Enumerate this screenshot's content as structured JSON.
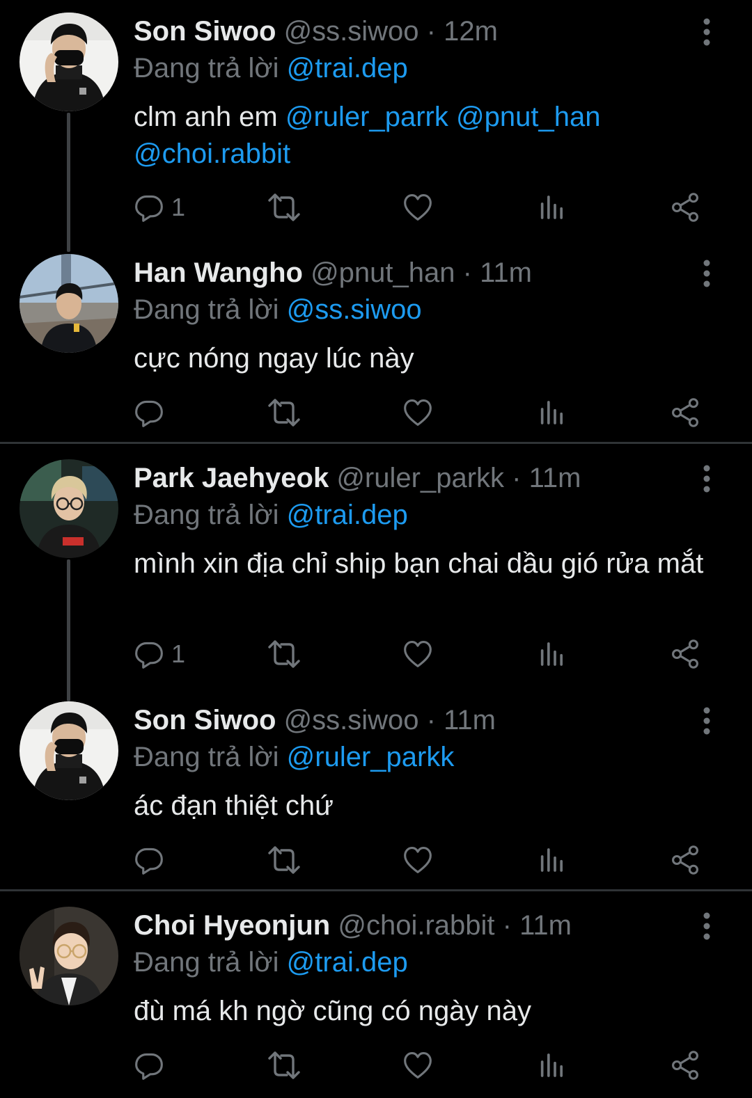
{
  "colors": {
    "background": "#000000",
    "text_primary": "#e7e9ea",
    "text_secondary": "#71767b",
    "accent_link": "#1d9bf0",
    "thread_line": "#3e4144",
    "divider": "#2f3336"
  },
  "tweets": [
    {
      "name": "Son Siwoo",
      "handle": "@ss.siwoo",
      "separator": "·",
      "time": "12m",
      "reply_prefix": "Đang trả lời",
      "reply_to": "@trai.dep",
      "body_text": "clm anh em ",
      "mentions": [
        "@ruler_parrk",
        "@pnut_han",
        "@choi.rabbit"
      ],
      "reply_count": "1",
      "avatar_icon": "avatar-masked-person",
      "menu_icon": "more-vertical-icon"
    },
    {
      "name": "Han Wangho",
      "handle": "@pnut_han",
      "separator": "·",
      "time": "11m",
      "reply_prefix": "Đang trả lời",
      "reply_to": "@ss.siwoo",
      "body_text": "cực nóng ngay lúc này",
      "reply_count": "",
      "avatar_icon": "avatar-person-bridge",
      "menu_icon": "more-vertical-icon"
    },
    {
      "name": "Park Jaehyeok",
      "handle": "@ruler_parkk",
      "separator": "·",
      "time": "11m",
      "reply_prefix": "Đang trả lời",
      "reply_to": "@trai.dep",
      "body_text": "mình xin địa chỉ ship bạn chai dầu gió rửa mắt",
      "reply_count": "1",
      "avatar_icon": "avatar-person-glasses",
      "menu_icon": "more-vertical-icon"
    },
    {
      "name": "Son Siwoo",
      "handle": "@ss.siwoo",
      "separator": "·",
      "time": "11m",
      "reply_prefix": "Đang trả lời",
      "reply_to": "@ruler_parkk",
      "body_text": "ác đạn thiệt chứ",
      "reply_count": "",
      "avatar_icon": "avatar-masked-person",
      "menu_icon": "more-vertical-icon"
    },
    {
      "name": "Choi Hyeonjun",
      "handle": "@choi.rabbit",
      "separator": "·",
      "time": "11m",
      "reply_prefix": "Đang trả lời",
      "reply_to": "@trai.dep",
      "body_text": "đù má kh ngờ cũng có ngày này",
      "reply_count": "",
      "avatar_icon": "avatar-person-v-sign",
      "menu_icon": "more-vertical-icon"
    }
  ],
  "action_icons": [
    "reply-icon",
    "retweet-icon",
    "like-icon",
    "analytics-icon",
    "share-icon"
  ]
}
